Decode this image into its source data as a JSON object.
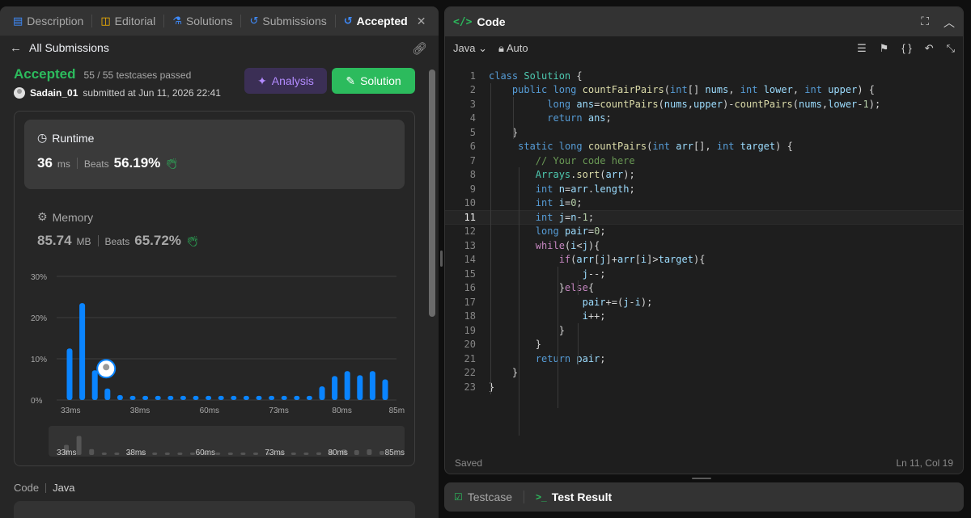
{
  "left_tabs": [
    {
      "label": "Description",
      "icon": "description-icon"
    },
    {
      "label": "Editorial",
      "icon": "book-icon"
    },
    {
      "label": "Solutions",
      "icon": "flask-icon"
    },
    {
      "label": "Submissions",
      "icon": "history-icon"
    },
    {
      "label": "Accepted",
      "icon": "history-icon",
      "active": true
    }
  ],
  "subheader": {
    "back_label": "All Submissions"
  },
  "submission": {
    "status": "Accepted",
    "testcases": "55 / 55 testcases passed",
    "username": "Sadain_01",
    "submitted_text": "submitted at Jun 11, 2026 22:41",
    "analysis_label": "Analysis",
    "solution_label": "Solution"
  },
  "runtime": {
    "title": "Runtime",
    "value": "36",
    "unit": "ms",
    "beats_label": "Beats",
    "beats_pct": "56.19%"
  },
  "memory": {
    "title": "Memory",
    "value": "85.74",
    "unit": "MB",
    "beats_label": "Beats",
    "beats_pct": "65.72%"
  },
  "chart_data": {
    "type": "bar",
    "yticks": [
      "30%",
      "20%",
      "10%",
      "0%"
    ],
    "ylim": [
      0,
      30
    ],
    "xtick_labels": [
      "33ms",
      "38ms",
      "60ms",
      "73ms",
      "80ms",
      "85ms"
    ],
    "values": [
      12.5,
      23.5,
      7.2,
      2.8,
      1.2,
      1.0,
      1.0,
      1.0,
      1.0,
      1.0,
      1.0,
      1.0,
      1.0,
      1.0,
      1.0,
      1.0,
      1.0,
      1.0,
      1.0,
      1.0,
      3.3,
      5.8,
      7.0,
      6.0,
      7.0,
      5.0
    ],
    "highlight_index": 2,
    "grid": true,
    "bar_color": "#0a84ff"
  },
  "mini_chart": {
    "xtick_labels": [
      "33ms",
      "38ms",
      "60ms",
      "73ms",
      "80ms",
      "85ms"
    ]
  },
  "code_section": {
    "label": "Code",
    "lang": "Java"
  },
  "editor": {
    "title": "Code",
    "language": "Java",
    "autosave": "Auto",
    "status_saved": "Saved",
    "cursor_pos": "Ln 11, Col 19",
    "current_line": 11
  },
  "code_lines": [
    "class Solution {",
    "    public long countFairPairs(int[] nums, int lower, int upper) {",
    "          long ans=countPairs(nums,upper)-countPairs(nums,lower-1);",
    "          return ans;",
    "    }",
    "     static long countPairs(int arr[], int target) {",
    "        // Your code here",
    "        Arrays.sort(arr);",
    "        int n=arr.length;",
    "        int i=0;",
    "        int j=n-1;",
    "        long pair=0;",
    "        while(i<j){",
    "            if(arr[j]+arr[i]>target){",
    "                j--;",
    "            }else{",
    "                pair+=(j-i);",
    "                i++;",
    "            }",
    "        }",
    "        return pair;",
    "    }",
    "}"
  ],
  "result_tabs": [
    {
      "label": "Testcase",
      "icon": "checkbox-icon"
    },
    {
      "label": "Test Result",
      "icon": "terminal-icon",
      "active": true
    }
  ],
  "colors": {
    "accent_green": "#2cbb5d",
    "bar_blue": "#0a84ff",
    "analysis_purple": "#b38bff"
  }
}
